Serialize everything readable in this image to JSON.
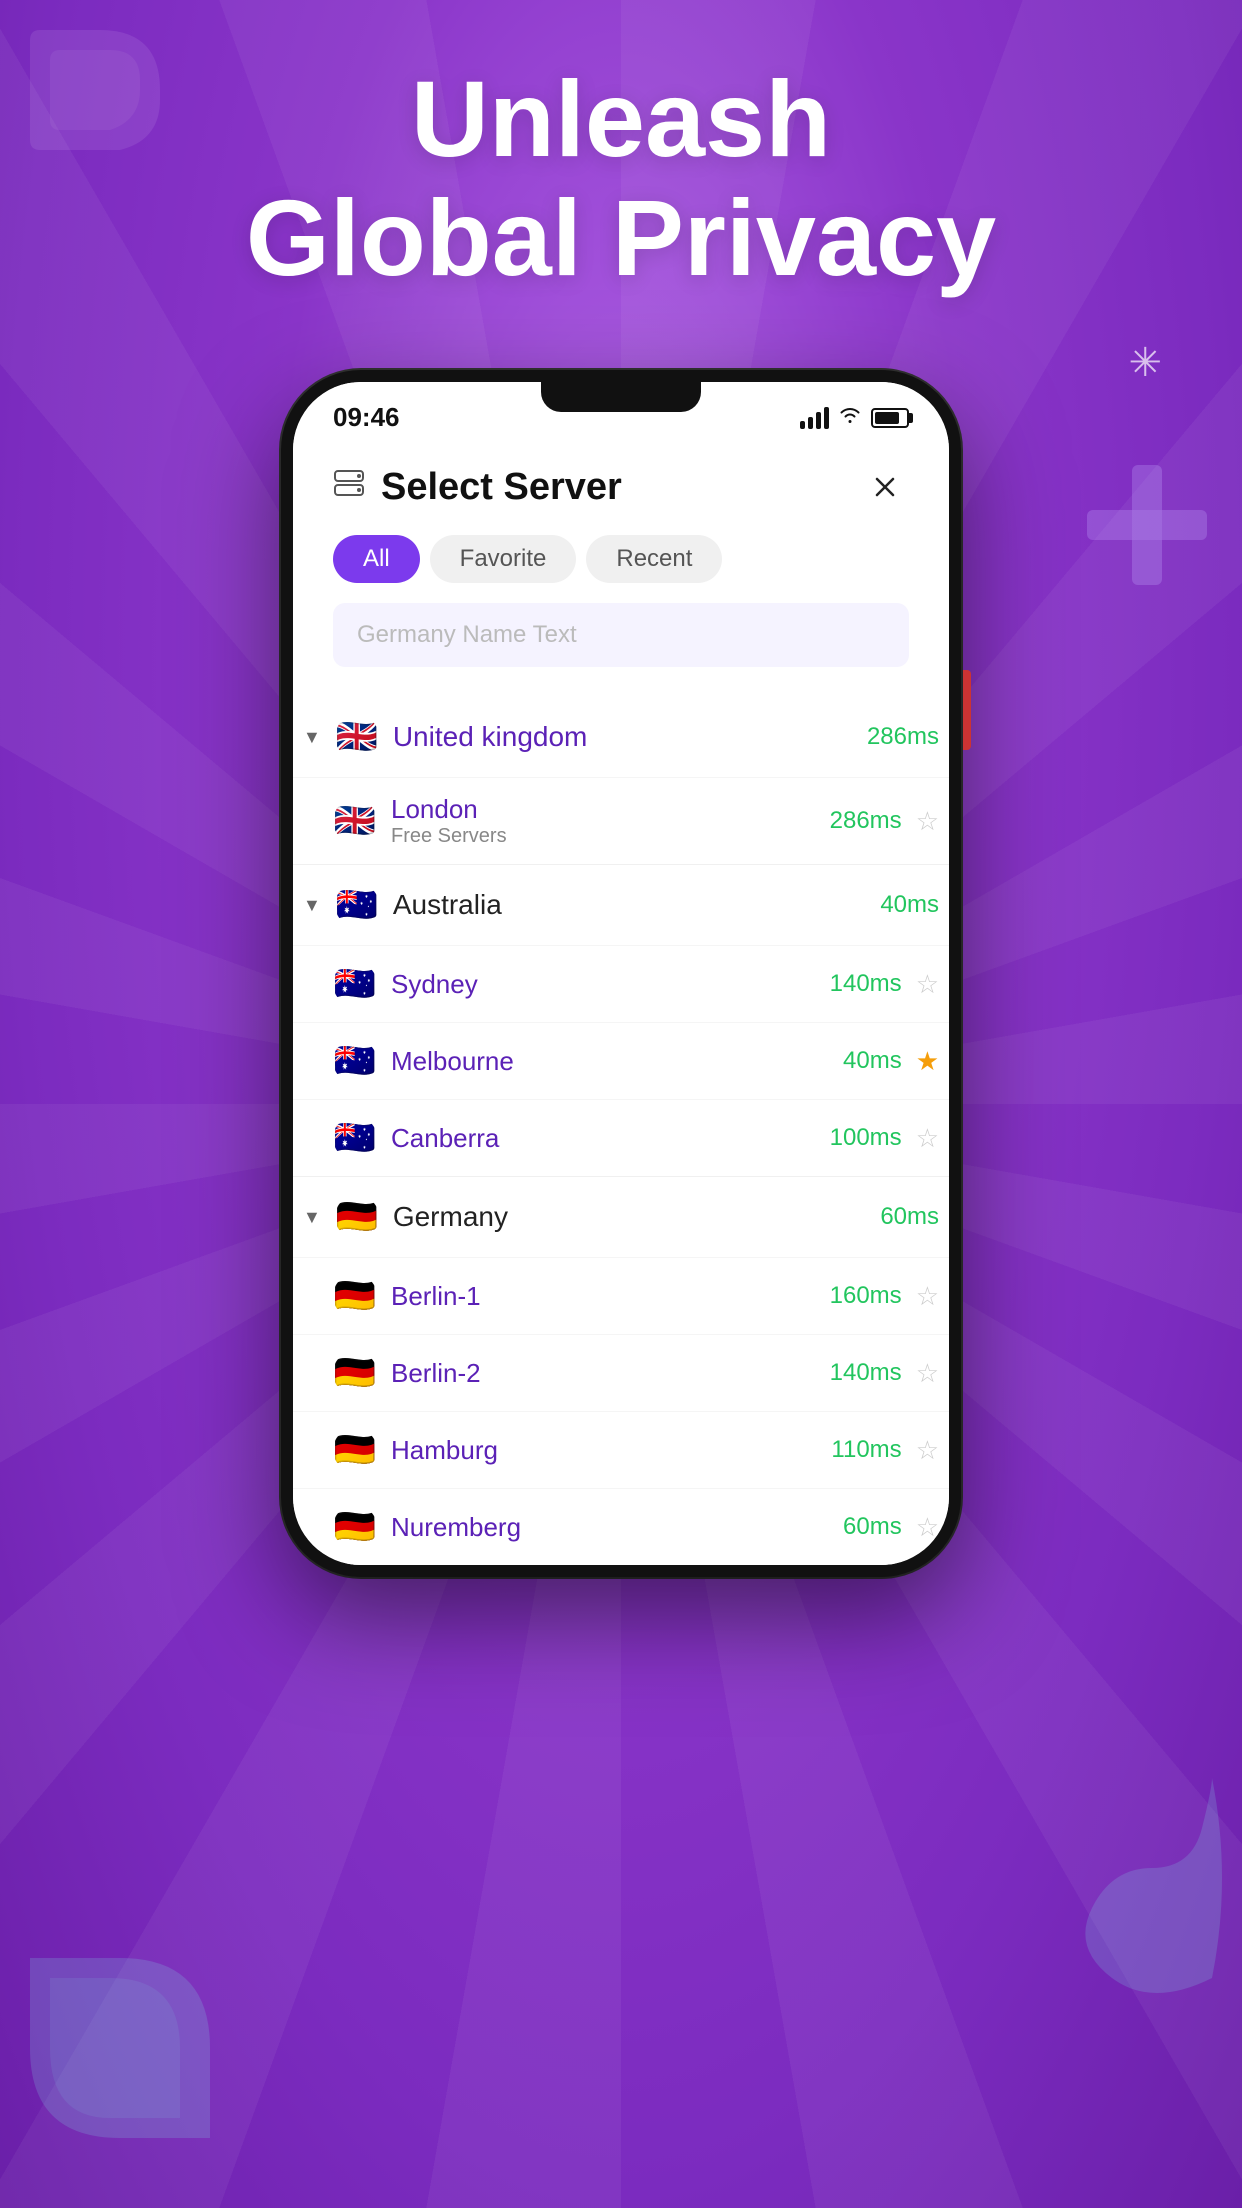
{
  "page": {
    "hero_title_line1": "Unleash",
    "hero_title_line2": "Global Privacy"
  },
  "status_bar": {
    "time": "09:46",
    "signal": "signal",
    "wifi": "wifi",
    "battery": "battery"
  },
  "app": {
    "header": {
      "icon": "☰",
      "title": "Select Server"
    },
    "tabs": [
      {
        "label": "All",
        "active": true
      },
      {
        "label": "Favorite",
        "active": false
      },
      {
        "label": "Recent",
        "active": false
      }
    ],
    "search": {
      "placeholder": "Germany Name Text"
    },
    "countries": [
      {
        "name": "United kingdom",
        "flag": "🇬🇧",
        "latency": "286ms",
        "expanded": true,
        "servers": [
          {
            "name": "London",
            "subtitle": "Free Servers",
            "latency": "286ms",
            "starred": false
          }
        ]
      },
      {
        "name": "Australia",
        "flag": "🇦🇺",
        "latency": "40ms",
        "expanded": true,
        "servers": [
          {
            "name": "Sydney",
            "subtitle": "",
            "latency": "140ms",
            "starred": false
          },
          {
            "name": "Melbourne",
            "subtitle": "",
            "latency": "40ms",
            "starred": true
          },
          {
            "name": "Canberra",
            "subtitle": "",
            "latency": "100ms",
            "starred": false
          }
        ]
      },
      {
        "name": "Germany",
        "flag": "🇩🇪",
        "latency": "60ms",
        "expanded": true,
        "servers": [
          {
            "name": "Berlin-1",
            "subtitle": "",
            "latency": "160ms",
            "starred": false
          },
          {
            "name": "Berlin-2",
            "subtitle": "",
            "latency": "140ms",
            "starred": false
          },
          {
            "name": "Hamburg",
            "subtitle": "",
            "latency": "110ms",
            "starred": false
          },
          {
            "name": "Nuremberg",
            "subtitle": "",
            "latency": "60ms",
            "starred": false
          }
        ]
      }
    ]
  }
}
